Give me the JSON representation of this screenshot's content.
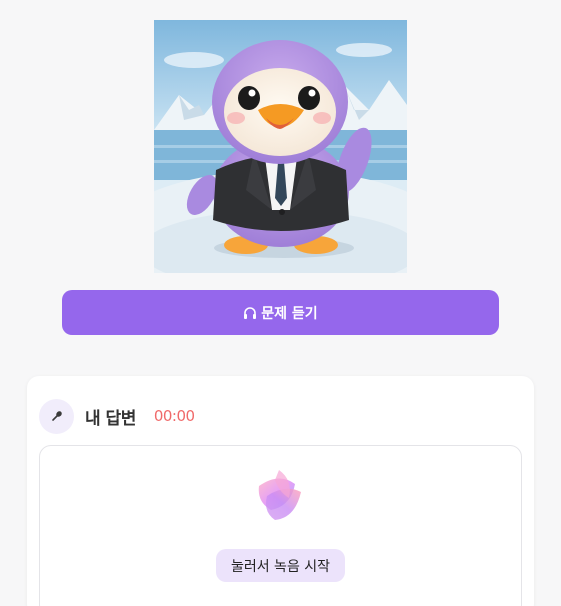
{
  "listen_button": {
    "icon": "headphone-icon",
    "label": "문제 듣기"
  },
  "answer": {
    "icon": "microphone-icon",
    "title": "내 답변",
    "timer": "00:00",
    "record_button": "눌러서 녹음 시작"
  },
  "colors": {
    "accent": "#9567ec",
    "timer": "#f06a6a",
    "record_button_bg": "#ece3fb"
  }
}
